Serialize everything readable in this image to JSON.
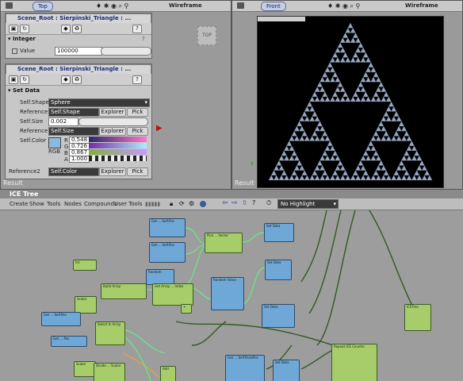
{
  "left_viewport": {
    "view_label": "Top",
    "display_mode": "Wireframe",
    "gizmo_label": "TOP",
    "footer": "Result"
  },
  "right_viewport": {
    "view_label": "Front",
    "display_mode": "Wireframe",
    "footer": "Result"
  },
  "property_panel_1": {
    "title": "Scene_Root : Sierpinski_Triangle : ...",
    "section": "Integer",
    "value_label": "Value",
    "value": "100000"
  },
  "property_panel_2": {
    "title": "Scene_Root : Sierpinski_Triangle : ...",
    "section": "Set Data",
    "rows": {
      "shape_label": "Self.Shape",
      "shape_value": "Sphere",
      "ref_label": "Reference",
      "ref_value": "Self.Shape",
      "size_label": "Self.Size",
      "size_value": "0.002",
      "ref1_label": "Reference1",
      "ref1_value": "Self.Size",
      "color_label": "Self.Color",
      "rgb_label": "RGB",
      "r_label": "R",
      "r_value": "0.548",
      "g_label": "G",
      "g_value": "0.726",
      "b_label": "B",
      "b_value": "0.867",
      "a_label": "A",
      "a_value": "1.000",
      "ref2_label": "Reference2",
      "ref2_value": "Self.Color",
      "explorer": "Explorer",
      "pick": "Pick"
    },
    "swatch_color": "#8cb9dd"
  },
  "ice_tree": {
    "title": "ICE Tree",
    "menu": [
      "Create",
      "Show",
      "Tools",
      "Nodes",
      "Compounds",
      "User Tools"
    ],
    "highlight": "No Highlight"
  },
  "colors": {
    "node_green": "#a6cd6a",
    "node_blue": "#6fa7d6",
    "wire_green": "#6fe08a",
    "wire_dark": "#2f5a1f"
  }
}
